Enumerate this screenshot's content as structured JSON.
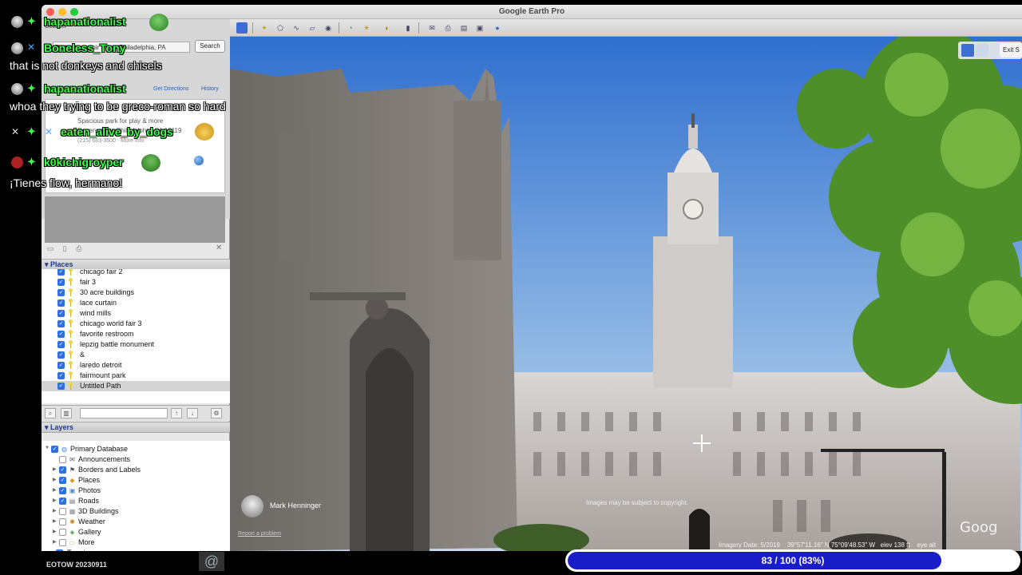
{
  "window": {
    "title": "Google Earth Pro"
  },
  "search": {
    "heading": "Search",
    "query": "Park, Reservoir Drive, Philadelphia, PA",
    "button": "Search",
    "get_directions": "Get Directions",
    "history": "History",
    "result_line1": "Spacious park for play & more",
    "result_line2": "Reservoir Dr, Philadelphia, PA 19119",
    "result_line3": "(215) 683-3600 · More info"
  },
  "places": {
    "header": "Places",
    "items": [
      {
        "label": "chicago fair 2",
        "checked": true
      },
      {
        "label": "fair 3",
        "checked": true
      },
      {
        "label": "30 acre buildings",
        "checked": true
      },
      {
        "label": "lace curtain",
        "checked": true
      },
      {
        "label": "wind mills",
        "checked": true
      },
      {
        "label": "chicago world fair 3",
        "checked": true
      },
      {
        "label": "favorite restroom",
        "checked": true
      },
      {
        "label": "lepzig battle monument",
        "checked": true
      },
      {
        "label": "&",
        "checked": true
      },
      {
        "label": "laredo detroit",
        "checked": true
      },
      {
        "label": "fairmount park",
        "checked": true
      },
      {
        "label": "Untitled Path",
        "checked": true,
        "selected": true
      }
    ]
  },
  "layers": {
    "header": "Layers",
    "items": [
      {
        "label": "Primary Database",
        "checked": true,
        "icon": "globe-icon"
      },
      {
        "label": "Announcements",
        "checked": false,
        "icon": "envelope-icon"
      },
      {
        "label": "Borders and Labels",
        "checked": true,
        "icon": "flag-icon"
      },
      {
        "label": "Places",
        "checked": true,
        "icon": "places-icon"
      },
      {
        "label": "Photos",
        "checked": true,
        "icon": "photo-icon"
      },
      {
        "label": "Roads",
        "checked": true,
        "icon": "road-icon"
      },
      {
        "label": "3D Buildings",
        "checked": false,
        "icon": "building-icon"
      },
      {
        "label": "Weather",
        "checked": false,
        "icon": "weather-icon"
      },
      {
        "label": "Gallery",
        "checked": false,
        "icon": "gallery-icon"
      },
      {
        "label": "More",
        "checked": false,
        "icon": "folder-icon"
      },
      {
        "label": "Terrain",
        "checked": true,
        "icon": ""
      }
    ]
  },
  "street_view": {
    "exit_label": "Exit S",
    "author": "Mark Henninger",
    "report": "Report a problem",
    "copyright": "Images may be subject to copyright.",
    "imagery_date": "Imagery Date: 5/2019",
    "coords": "39°57'11.16\" N   75°09'48.53\" W",
    "elevation": "elev  138 ft",
    "eye_alt": "eye alt",
    "watermark": "Goog"
  },
  "chat": {
    "messages": [
      {
        "user": "hapanationalist",
        "text": ""
      },
      {
        "user": "Boneless_Tony",
        "text": "that is not donkeys and chisels"
      },
      {
        "user": "hapanationalist",
        "text": "whoa they trying to be greco-roman so hard"
      },
      {
        "user": "eaten_alive_by_dogs",
        "text": ""
      },
      {
        "user": "k0kichigroyper",
        "text": "¡Tienes flow, hermano!"
      }
    ]
  },
  "bottom": {
    "stream_label": "EOTOW 20230911",
    "at_symbol": "@",
    "progress_label": "83 / 100 (83%)",
    "progress_value": 0.83,
    "progress_color": "#1a1ec8"
  }
}
